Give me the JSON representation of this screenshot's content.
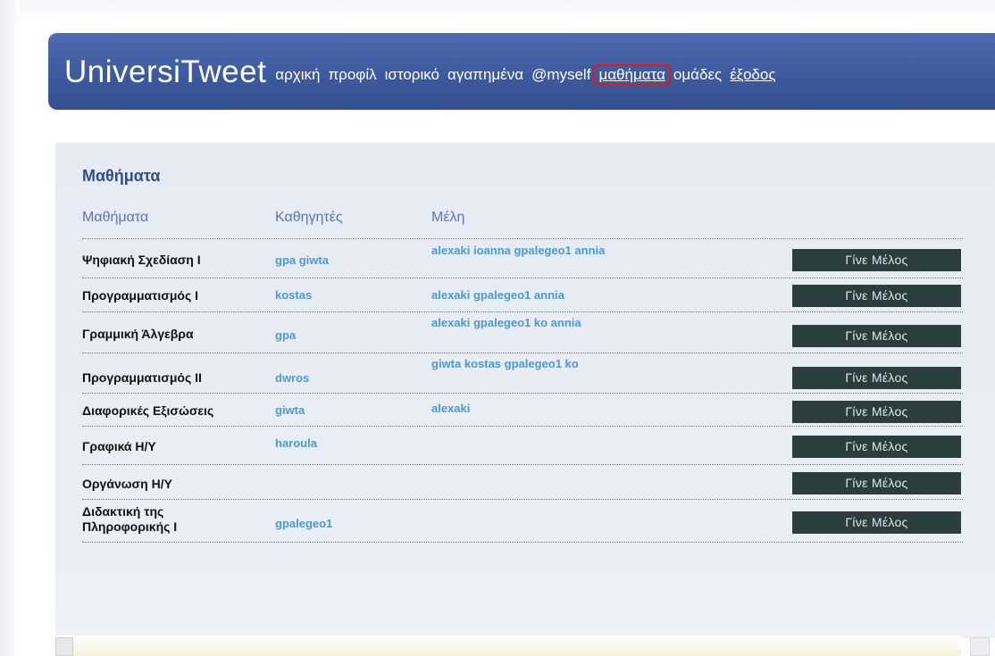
{
  "header": {
    "brand": "UniversiTweet",
    "nav": [
      {
        "label": "αρχική"
      },
      {
        "label": "προφίλ"
      },
      {
        "label": "ιστορικό"
      },
      {
        "label": "αγαπημένα"
      },
      {
        "label": "@myself"
      },
      {
        "label": "μαθήματα",
        "active": true
      },
      {
        "label": "ομάδες"
      },
      {
        "label": "έξοδος"
      }
    ]
  },
  "page": {
    "title": "Μαθήματα"
  },
  "table": {
    "headers": {
      "course": "Μαθήματα",
      "teachers": "Καθηγητές",
      "members": "Μέλη"
    },
    "join_label": "Γίνε Μέλος",
    "rows": [
      {
        "course": "Ψηφιακή Σχεδίαση Ι",
        "teachers": "gpa giwta",
        "members": "alexaki ioanna gpalegeo1 annia"
      },
      {
        "course": "Προγραμματισμός Ι",
        "teachers": "kostas",
        "members": "alexaki gpalegeo1 annia"
      },
      {
        "course": "Γραμμική Άλγεβρα",
        "teachers": "gpa",
        "members": "alexaki gpalegeo1 ko annia"
      },
      {
        "course": "Προγραμματισμός ΙΙ",
        "teachers": "dwros",
        "members": "giwta kostas gpalegeo1 ko"
      },
      {
        "course": "Διαφορικές Εξισώσεις",
        "teachers": "giwta",
        "members": "alexaki"
      },
      {
        "course": "Γραφικά Η/Υ",
        "teachers": "haroula",
        "members": ""
      },
      {
        "course": "Οργάνωση Η/Υ",
        "teachers": "",
        "members": ""
      },
      {
        "course": "Διδακτική της Πληροφορικής Ι",
        "teachers": "gpalegeo1",
        "members": ""
      }
    ]
  }
}
